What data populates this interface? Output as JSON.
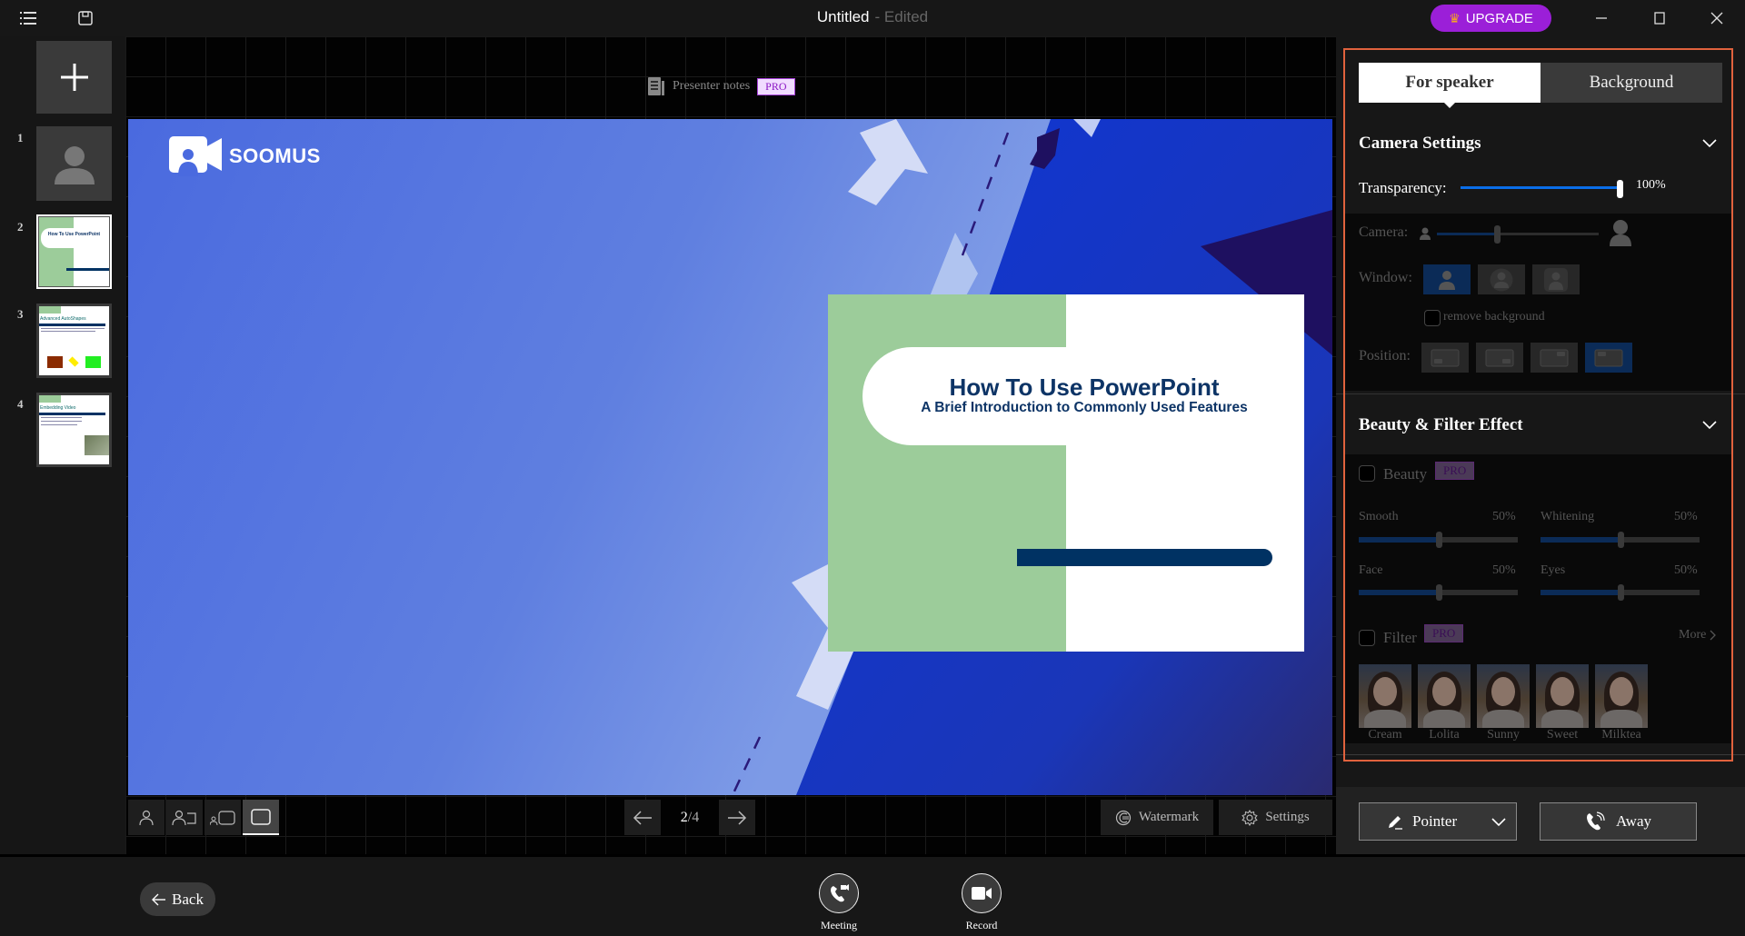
{
  "titlebar": {
    "title": "Untitled",
    "status": "- Edited",
    "upgrade_label": "UPGRADE",
    "icons": [
      "menu-icon",
      "save-icon",
      "crown-icon",
      "minimize-icon",
      "maximize-icon",
      "close-icon"
    ]
  },
  "sidebar": {
    "add_slide_icon": "plus-icon",
    "thumbnails": [
      {
        "number": "1",
        "kind": "camera-placeholder",
        "selected": false
      },
      {
        "number": "2",
        "kind": "slide",
        "title": "How To Use PowerPoint",
        "selected": true
      },
      {
        "number": "3",
        "kind": "slide",
        "title": "Advanced AutoShapes",
        "selected": false
      },
      {
        "number": "4",
        "kind": "slide",
        "title": "Embedding Video",
        "selected": false
      }
    ]
  },
  "stage": {
    "presenter_notes_label": "Presenter notes",
    "pro_label": "PRO",
    "logo_text": "SOOMUS",
    "slide_title": "How To Use PowerPoint",
    "slide_subtitle": "A Brief Introduction to Commonly Used Features",
    "layout_modes": [
      "camera-only",
      "camera-left-of-slide",
      "camera-small-with-slide",
      "slide-only"
    ],
    "active_layout": "slide-only",
    "page_current": "2",
    "page_total": "/4",
    "watermark_label": "Watermark",
    "settings_label": "Settings"
  },
  "panel": {
    "tabs": [
      {
        "label": "For speaker",
        "active": true
      },
      {
        "label": "Background",
        "active": false
      }
    ],
    "camera_settings": {
      "title": "Camera Settings",
      "transparency_label": "Transparency:",
      "transparency_value": "100%",
      "transparency_fraction": 1.0,
      "camera_label": "Camera:",
      "camera_size_fraction": 0.4,
      "window_label": "Window:",
      "window_shapes": [
        "square",
        "circle",
        "rounded"
      ],
      "window_active": 0,
      "remove_background_label": "remove background",
      "remove_background_checked": false,
      "position_label": "Position:",
      "positions": [
        "bottom-left",
        "bottom-right",
        "top-right",
        "top-left"
      ],
      "position_active": 3
    },
    "beauty_filter": {
      "title": "Beauty & Filter Effect",
      "beauty_label": "Beauty",
      "beauty_checked": false,
      "pro_label": "PRO",
      "sliders": [
        {
          "label": "Smooth",
          "value": "50%",
          "fraction": 0.5
        },
        {
          "label": "Whitening",
          "value": "50%",
          "fraction": 0.5
        },
        {
          "label": "Face",
          "value": "50%",
          "fraction": 0.5
        },
        {
          "label": "Eyes",
          "value": "50%",
          "fraction": 0.5
        }
      ],
      "filter_label": "Filter",
      "filter_checked": false,
      "more_label": "More",
      "filters": [
        "Cream",
        "Lolita",
        "Sunny",
        "Sweet",
        "Milktea"
      ]
    },
    "pointer_label": "Pointer",
    "away_label": "Away"
  },
  "footer": {
    "back_label": "Back",
    "meeting_label": "Meeting",
    "record_label": "Record"
  }
}
